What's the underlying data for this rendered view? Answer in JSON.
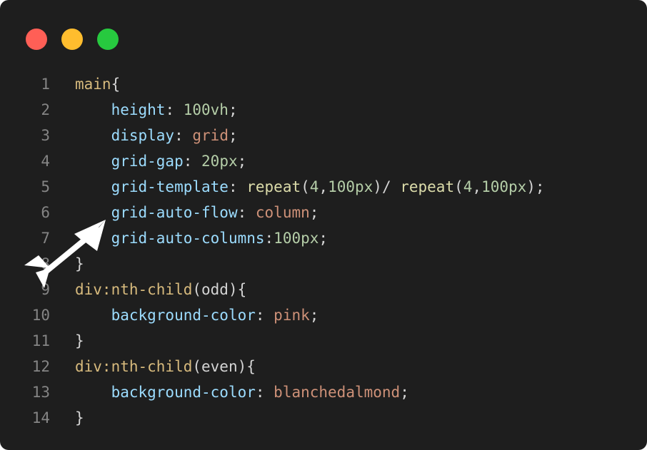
{
  "window_controls": {
    "close_color": "#ff5f56",
    "minimize_color": "#ffbd2e",
    "maximize_color": "#27c93f"
  },
  "code": {
    "lines": [
      {
        "n": "1",
        "tokens": [
          {
            "t": "main",
            "c": "sel"
          },
          {
            "t": "{",
            "c": "punc"
          }
        ]
      },
      {
        "n": "2",
        "tokens": [
          {
            "t": "    ",
            "c": "punc"
          },
          {
            "t": "height",
            "c": "prop"
          },
          {
            "t": ": ",
            "c": "punc"
          },
          {
            "t": "100vh",
            "c": "num"
          },
          {
            "t": ";",
            "c": "punc"
          }
        ]
      },
      {
        "n": "3",
        "tokens": [
          {
            "t": "    ",
            "c": "punc"
          },
          {
            "t": "display",
            "c": "prop"
          },
          {
            "t": ": ",
            "c": "punc"
          },
          {
            "t": "grid",
            "c": "kw"
          },
          {
            "t": ";",
            "c": "punc"
          }
        ]
      },
      {
        "n": "4",
        "tokens": [
          {
            "t": "    ",
            "c": "punc"
          },
          {
            "t": "grid-gap",
            "c": "prop"
          },
          {
            "t": ": ",
            "c": "punc"
          },
          {
            "t": "20px",
            "c": "num"
          },
          {
            "t": ";",
            "c": "punc"
          }
        ]
      },
      {
        "n": "5",
        "tokens": [
          {
            "t": "    ",
            "c": "punc"
          },
          {
            "t": "grid-template",
            "c": "prop"
          },
          {
            "t": ": ",
            "c": "punc"
          },
          {
            "t": "repeat",
            "c": "fn"
          },
          {
            "t": "(",
            "c": "punc"
          },
          {
            "t": "4",
            "c": "num"
          },
          {
            "t": ",",
            "c": "punc"
          },
          {
            "t": "100px",
            "c": "num"
          },
          {
            "t": ")/ ",
            "c": "punc"
          },
          {
            "t": "repeat",
            "c": "fn"
          },
          {
            "t": "(",
            "c": "punc"
          },
          {
            "t": "4",
            "c": "num"
          },
          {
            "t": ",",
            "c": "punc"
          },
          {
            "t": "100px",
            "c": "num"
          },
          {
            "t": ");",
            "c": "punc"
          }
        ]
      },
      {
        "n": "6",
        "tokens": [
          {
            "t": "    ",
            "c": "punc"
          },
          {
            "t": "grid-auto-flow",
            "c": "prop"
          },
          {
            "t": ": ",
            "c": "punc"
          },
          {
            "t": "column",
            "c": "kw"
          },
          {
            "t": ";",
            "c": "punc"
          }
        ]
      },
      {
        "n": "7",
        "tokens": [
          {
            "t": "    ",
            "c": "punc"
          },
          {
            "t": "grid-auto-columns",
            "c": "prop"
          },
          {
            "t": ":",
            "c": "punc"
          },
          {
            "t": "100px",
            "c": "num"
          },
          {
            "t": ";",
            "c": "punc"
          }
        ]
      },
      {
        "n": "8",
        "tokens": [
          {
            "t": "}",
            "c": "punc"
          }
        ]
      },
      {
        "n": "9",
        "tokens": [
          {
            "t": "div:nth-child",
            "c": "sel"
          },
          {
            "t": "(odd){",
            "c": "punc"
          }
        ]
      },
      {
        "n": "10",
        "tokens": [
          {
            "t": "    ",
            "c": "punc"
          },
          {
            "t": "background-color",
            "c": "prop"
          },
          {
            "t": ": ",
            "c": "punc"
          },
          {
            "t": "pink",
            "c": "kw"
          },
          {
            "t": ";",
            "c": "punc"
          }
        ]
      },
      {
        "n": "11",
        "tokens": [
          {
            "t": "}",
            "c": "punc"
          }
        ]
      },
      {
        "n": "12",
        "tokens": [
          {
            "t": "div:nth-child",
            "c": "sel"
          },
          {
            "t": "(even){",
            "c": "punc"
          }
        ]
      },
      {
        "n": "13",
        "tokens": [
          {
            "t": "    ",
            "c": "punc"
          },
          {
            "t": "background-color",
            "c": "prop"
          },
          {
            "t": ": ",
            "c": "punc"
          },
          {
            "t": "blanchedalmond",
            "c": "kw"
          },
          {
            "t": ";",
            "c": "punc"
          }
        ]
      },
      {
        "n": "14",
        "tokens": [
          {
            "t": "}",
            "c": "punc"
          }
        ]
      }
    ]
  },
  "overlay": {
    "icon": "arrow-pointer-icon",
    "color": "#ffffff"
  }
}
